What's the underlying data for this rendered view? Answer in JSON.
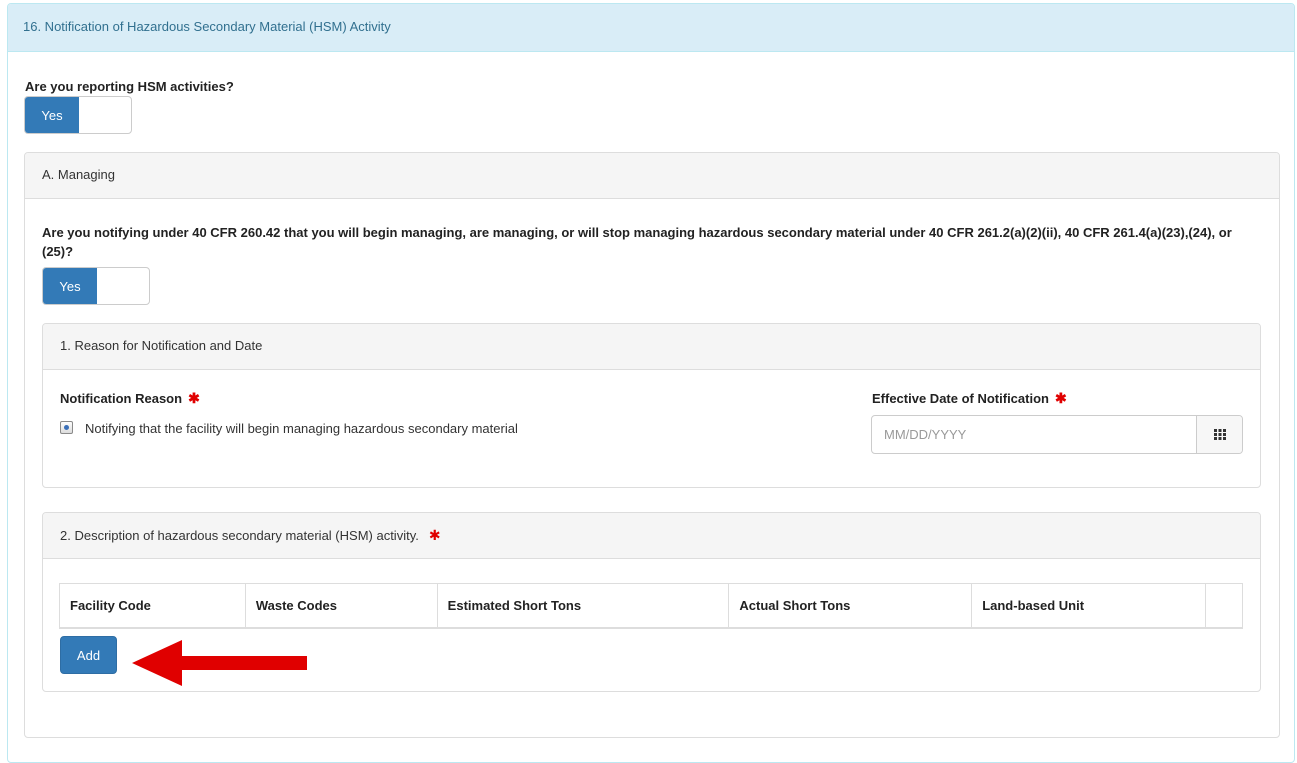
{
  "section": {
    "title": "16. Notification of Hazardous Secondary Material (HSM) Activity",
    "question": "Are you reporting HSM activities?",
    "toggle_label": "Yes"
  },
  "managing": {
    "title": "A. Managing",
    "question": "Are you notifying under 40 CFR 260.42 that you will begin managing, are managing, or will stop managing hazardous secondary material under 40 CFR 261.2(a)(2)(ii), 40 CFR 261.4(a)(23),(24), or (25)?",
    "toggle_label": "Yes"
  },
  "reason": {
    "title": "1. Reason for Notification and Date",
    "notification_reason_label": "Notification Reason",
    "option_label": "Notifying that the facility will begin managing hazardous secondary material",
    "effective_date_label": "Effective Date of Notification",
    "date_placeholder": "MM/DD/YYYY"
  },
  "description": {
    "title": "2. Description of hazardous secondary material (HSM) activity.",
    "columns": [
      "Facility Code",
      "Waste Codes",
      "Estimated Short Tons",
      "Actual Short Tons",
      "Land-based Unit",
      ""
    ],
    "add_label": "Add"
  },
  "required_marker": "✱",
  "colors": {
    "primary": "#337ab7",
    "info_bg": "#d9edf7",
    "required": "#e00000",
    "annotation_arrow": "#e00000"
  },
  "icons": {
    "calendar": "calendar-grid-icon",
    "arrow": "red-arrow-left-icon"
  }
}
